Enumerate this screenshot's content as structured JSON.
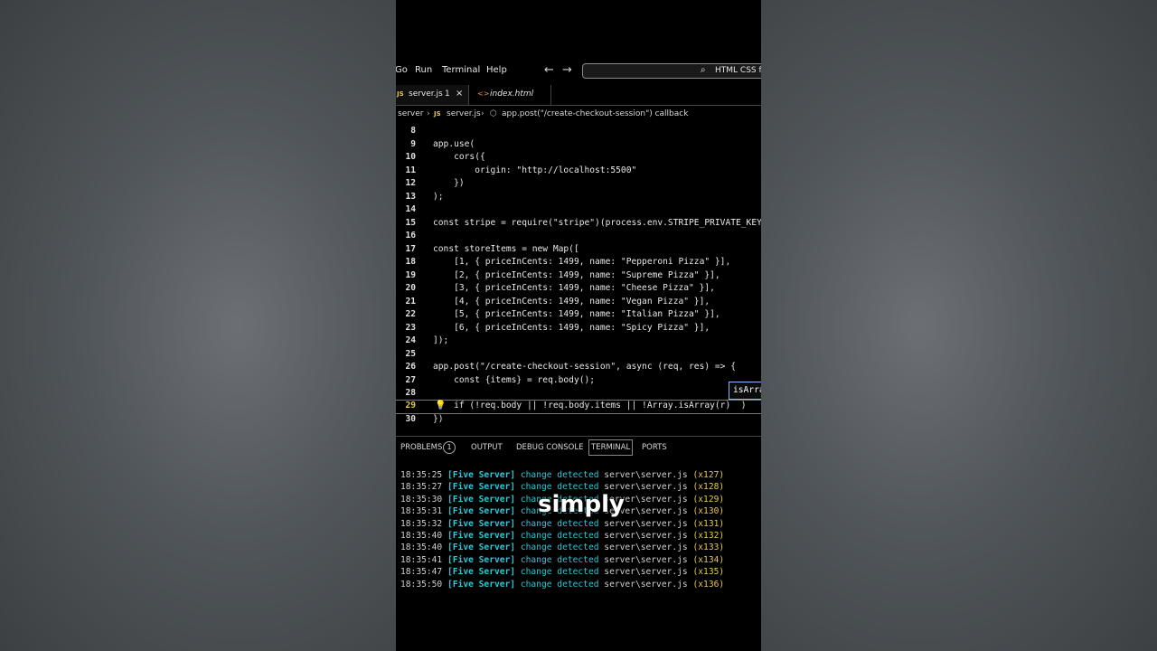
{
  "menu": {
    "items": [
      "Go",
      "Run",
      "Terminal",
      "Help"
    ],
    "search_text": "HTML CSS fr"
  },
  "tabs": [
    {
      "label": "server.js",
      "badge": "1",
      "close": "×",
      "lang": "JS"
    },
    {
      "label": "index.html",
      "icon": "<>"
    }
  ],
  "breadcrumb": [
    "server",
    "JS",
    "server.js",
    "app.post(\"/create-checkout-session\") callback"
  ],
  "editor": {
    "lines": [
      {
        "n": "8",
        "text": ""
      },
      {
        "n": "9",
        "text": "app.use("
      },
      {
        "n": "10",
        "text": "    cors({"
      },
      {
        "n": "11",
        "text": "        origin: \"http://localhost:5500\""
      },
      {
        "n": "12",
        "text": "    })"
      },
      {
        "n": "13",
        "text": ");"
      },
      {
        "n": "14",
        "text": ""
      },
      {
        "n": "15",
        "text": "const stripe = require(\"stripe\")(process.env.STRIPE_PRIVATE_KEY"
      },
      {
        "n": "16",
        "text": ""
      },
      {
        "n": "17",
        "text": "const storeItems = new Map(["
      },
      {
        "n": "18",
        "text": "    [1, { priceInCents: 1499, name: \"Pepperoni Pizza\" }],"
      },
      {
        "n": "19",
        "text": "    [2, { priceInCents: 1499, name: \"Supreme Pizza\" }],"
      },
      {
        "n": "20",
        "text": "    [3, { priceInCents: 1499, name: \"Cheese Pizza\" }],"
      },
      {
        "n": "21",
        "text": "    [4, { priceInCents: 1499, name: \"Vegan Pizza\" }],"
      },
      {
        "n": "22",
        "text": "    [5, { priceInCents: 1499, name: \"Italian Pizza\" }],"
      },
      {
        "n": "23",
        "text": "    [6, { priceInCents: 1499, name: \"Spicy Pizza\" }],"
      },
      {
        "n": "24",
        "text": "]);"
      },
      {
        "n": "25",
        "text": ""
      },
      {
        "n": "26",
        "text": "app.post(\"/create-checkout-session\", async (req, res) => {"
      },
      {
        "n": "27",
        "text": "    const {items} = req.body();"
      },
      {
        "n": "28",
        "text": ""
      },
      {
        "n": "29",
        "text": "    if (!req.body || !req.body.items || !Array.isArray(r)  )"
      },
      {
        "n": "30",
        "text": "})"
      }
    ],
    "suggestion": "isArra"
  },
  "panel": {
    "tabs": [
      "PROBLEMS",
      "OUTPUT",
      "DEBUG CONSOLE",
      "TERMINAL",
      "PORTS"
    ],
    "problems_count": "1",
    "active": "TERMINAL"
  },
  "terminal": [
    {
      "time": "18:35:25",
      "src": "[Five Server]",
      "msg": "change detected",
      "file": "server\\server.js",
      "count": "(x127)"
    },
    {
      "time": "18:35:27",
      "src": "[Five Server]",
      "msg": "change detected",
      "file": "server\\server.js",
      "count": "(x128)"
    },
    {
      "time": "18:35:30",
      "src": "[Five Server]",
      "msg": "change detected",
      "file": "server\\server.js",
      "count": "(x129)"
    },
    {
      "time": "18:35:31",
      "src": "[Five Server]",
      "msg": "change detected",
      "file": "server\\server.js",
      "count": "(x130)"
    },
    {
      "time": "18:35:32",
      "src": "[Five Server]",
      "msg": "change detected",
      "file": "server\\server.js",
      "count": "(x131)"
    },
    {
      "time": "18:35:40",
      "src": "[Five Server]",
      "msg": "change detected",
      "file": "server\\server.js",
      "count": "(x132)"
    },
    {
      "time": "18:35:40",
      "src": "[Five Server]",
      "msg": "change detected",
      "file": "server\\server.js",
      "count": "(x133)"
    },
    {
      "time": "18:35:41",
      "src": "[Five Server]",
      "msg": "change detected",
      "file": "server\\server.js",
      "count": "(x134)"
    },
    {
      "time": "18:35:47",
      "src": "[Five Server]",
      "msg": "change detected",
      "file": "server\\server.js",
      "count": "(x135)"
    },
    {
      "time": "18:35:50",
      "src": "[Five Server]",
      "msg": "change detected",
      "file": "server\\server.js",
      "count": "(x136)"
    }
  ],
  "caption": "simply",
  "colors": {
    "keyword": "#7aa6ff",
    "string": "#f0b48a",
    "terminal_accent": "#29c8d8",
    "count": "#e7c94d"
  }
}
